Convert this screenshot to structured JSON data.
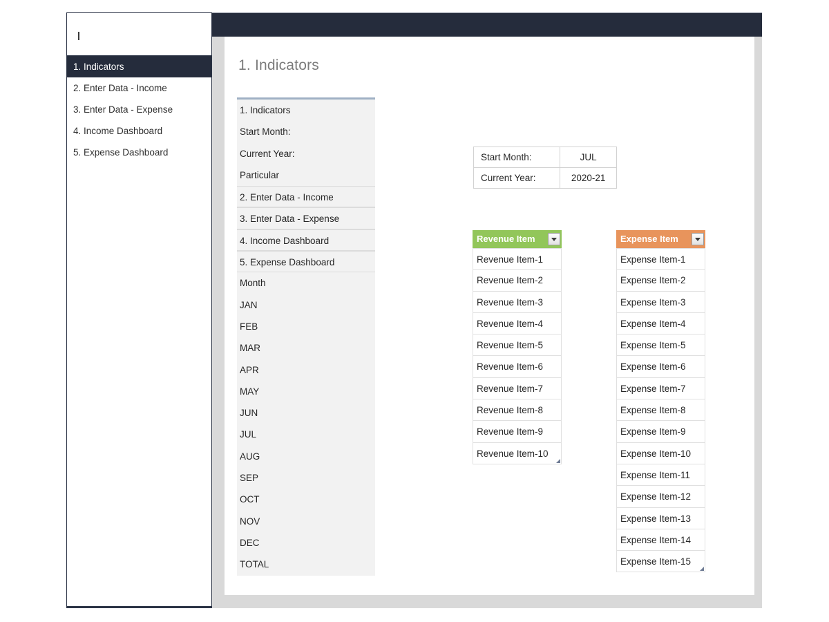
{
  "window": {
    "titlebar_color": "#252c3c",
    "gutter_color": "#d9d9d9"
  },
  "sidebar": {
    "caret_marker": "text-cursor",
    "items": [
      {
        "label": "1. Indicators",
        "selected": true
      },
      {
        "label": "2. Enter Data - Income",
        "selected": false
      },
      {
        "label": "3. Enter Data - Expense",
        "selected": false
      },
      {
        "label": "4. Income Dashboard",
        "selected": false
      },
      {
        "label": "5. Expense Dashboard",
        "selected": false
      }
    ]
  },
  "main": {
    "page_title": "1. Indicators"
  },
  "indicator_list": {
    "rows": [
      {
        "label": "1. Indicators",
        "ruled": false
      },
      {
        "label": "Start Month:",
        "ruled": false
      },
      {
        "label": "Current Year:",
        "ruled": false
      },
      {
        "label": "Particular",
        "ruled": false
      },
      {
        "label": "2. Enter Data - Income",
        "ruled": true
      },
      {
        "label": "3. Enter Data - Expense",
        "ruled": true
      },
      {
        "label": "4. Income Dashboard",
        "ruled": true
      },
      {
        "label": "5. Expense Dashboard",
        "ruled": true
      },
      {
        "label": "Month",
        "ruled": false
      },
      {
        "label": "JAN",
        "ruled": false
      },
      {
        "label": "FEB",
        "ruled": false
      },
      {
        "label": "MAR",
        "ruled": false
      },
      {
        "label": "APR",
        "ruled": false
      },
      {
        "label": "MAY",
        "ruled": false
      },
      {
        "label": "JUN",
        "ruled": false
      },
      {
        "label": "JUL",
        "ruled": false
      },
      {
        "label": "AUG",
        "ruled": false
      },
      {
        "label": "SEP",
        "ruled": false
      },
      {
        "label": "OCT",
        "ruled": false
      },
      {
        "label": "NOV",
        "ruled": false
      },
      {
        "label": "DEC",
        "ruled": false
      },
      {
        "label": "TOTAL",
        "ruled": false
      }
    ]
  },
  "settings": {
    "rows": [
      {
        "label": "Start Month:",
        "value": "JUL"
      },
      {
        "label": "Current Year:",
        "value": "2020-21"
      }
    ]
  },
  "revenue_table": {
    "header": "Revenue Item",
    "header_color": "#92c65a",
    "filter_icon": "filter-dropdown-icon",
    "items": [
      "Revenue Item-1",
      "Revenue Item-2",
      "Revenue Item-3",
      "Revenue Item-4",
      "Revenue Item-5",
      "Revenue Item-6",
      "Revenue Item-7",
      "Revenue Item-8",
      "Revenue Item-9",
      "Revenue Item-10"
    ]
  },
  "expense_table": {
    "header": "Expense Item",
    "header_color": "#e8945c",
    "filter_icon": "filter-dropdown-icon",
    "items": [
      "Expense Item-1",
      "Expense Item-2",
      "Expense Item-3",
      "Expense Item-4",
      "Expense Item-5",
      "Expense Item-6",
      "Expense Item-7",
      "Expense Item-8",
      "Expense Item-9",
      "Expense Item-10",
      "Expense Item-11",
      "Expense Item-12",
      "Expense Item-13",
      "Expense Item-14",
      "Expense Item-15"
    ]
  }
}
